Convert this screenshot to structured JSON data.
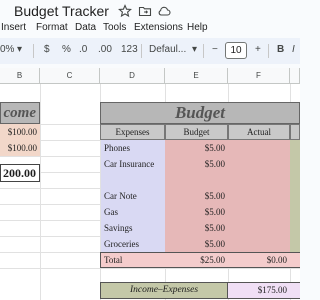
{
  "app": {
    "title": "Budget Tracker",
    "menus": [
      "Insert",
      "Format",
      "Data",
      "Tools",
      "Extensions",
      "Help"
    ]
  },
  "toolbar": {
    "zoom": "0%",
    "currency": "$",
    "percent": "%",
    "dec_decrease": ".0",
    "dec_increase": ".00",
    "number_format": "123",
    "font": "Defaul...",
    "minus": "−",
    "font_size": "10",
    "plus": "+",
    "bold": "B",
    "italic": "I"
  },
  "columns": [
    "B",
    "C",
    "D",
    "E",
    "F"
  ],
  "income": {
    "header": "come",
    "rows": [
      "$100.00",
      "$100.00"
    ],
    "total": "200.00"
  },
  "budget": {
    "title": "Budget",
    "headers": [
      "Expenses",
      "Budget",
      "Actual"
    ],
    "rows": [
      {
        "expense": "Phones",
        "budget": "$5.00",
        "actual": ""
      },
      {
        "expense": "Car Insurance",
        "budget": "$5.00",
        "actual": ""
      },
      {
        "expense": "",
        "budget": "",
        "actual": ""
      },
      {
        "expense": "Car Note",
        "budget": "$5.00",
        "actual": ""
      },
      {
        "expense": "Gas",
        "budget": "$5.00",
        "actual": ""
      },
      {
        "expense": "Savings",
        "budget": "$5.00",
        "actual": ""
      },
      {
        "expense": "Groceries",
        "budget": "$5.00",
        "actual": ""
      }
    ],
    "total_label": "Total",
    "total_budget": "$25.00",
    "total_actual": "$0.00"
  },
  "summary": {
    "label": "Income–Expenses",
    "value": "$175.00"
  },
  "colors": {
    "header_gray": "#b7b7b7",
    "budget_pink": "#e6b8b8",
    "expense_lavender": "#d9d9f3",
    "total_pink": "#f4cccc",
    "olive": "#c4c8a8",
    "income_tan": "#f2d7c9"
  }
}
